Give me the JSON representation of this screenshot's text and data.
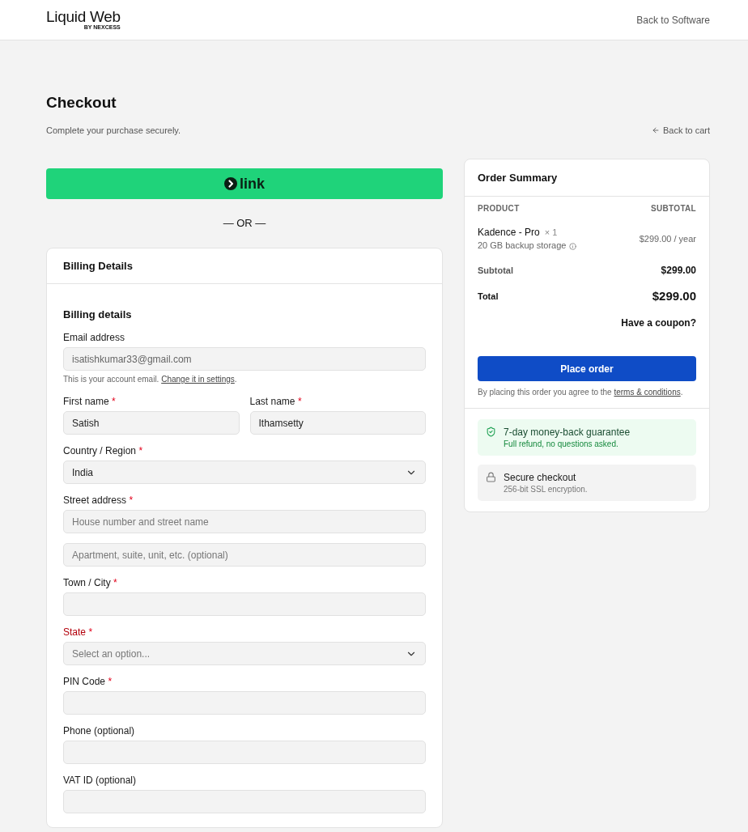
{
  "header": {
    "logo": "Liquid Web",
    "logo_byline": "BY NEXCESS",
    "back_link": "Back to Software"
  },
  "page": {
    "title": "Checkout",
    "subtitle": "Complete your purchase securely.",
    "back_link": "Back to cart"
  },
  "express": {
    "button_label": "link",
    "divider": "— OR —"
  },
  "billing": {
    "card_title": "Billing Details",
    "section_title": "Billing details",
    "rows": [
      {
        "fields": [
          {
            "kind": "text",
            "label": "Email address",
            "value": "isatishkumar33@gmail.com",
            "disabled": true,
            "invalid": false,
            "hint": {
              "text": "This is your account email.",
              "link": "Change it in settings",
              "end": "."
            }
          }
        ]
      },
      {
        "fields": [
          {
            "kind": "text",
            "label": "First name",
            "required_mark": "*",
            "value": "Satish",
            "disabled": false,
            "invalid": false
          },
          {
            "kind": "text",
            "label": "Last name",
            "required_mark": "*",
            "value": "Ithamsetty",
            "disabled": false,
            "invalid": false
          }
        ]
      },
      {
        "fields": [
          {
            "kind": "select",
            "label": "Country / Region",
            "required_mark": "*",
            "value": "India",
            "disabled": false,
            "invalid": false
          }
        ]
      },
      {
        "fields": [
          {
            "kind": "text",
            "label": "Street address",
            "required_mark": "*",
            "placeholder": "House number and street name",
            "disabled": false,
            "invalid": false
          }
        ]
      },
      {
        "fields": [
          {
            "kind": "text",
            "placeholder": "Apartment, suite, unit, etc. (optional)",
            "disabled": false,
            "invalid": false
          }
        ]
      },
      {
        "fields": [
          {
            "kind": "text",
            "label": "Town / City",
            "required_mark": "*",
            "invalid": false
          }
        ]
      },
      {
        "fields": [
          {
            "kind": "select",
            "label": "State",
            "required_mark": "*",
            "placeholder": "Select an option...",
            "disabled": false,
            "invalid": true
          }
        ]
      },
      {
        "fields": [
          {
            "kind": "text",
            "label": "PIN Code",
            "required_mark": "*",
            "invalid": false
          }
        ]
      },
      {
        "fields": [
          {
            "kind": "text",
            "label": "Phone (optional)",
            "invalid": false
          }
        ]
      },
      {
        "fields": [
          {
            "kind": "text",
            "label": "VAT ID (optional)",
            "invalid": false
          }
        ]
      }
    ]
  },
  "order_summary": {
    "title": "Order Summary",
    "columns": [
      "PRODUCT",
      "SUBTOTAL"
    ],
    "items": [
      {
        "name": "Kadence - Pro",
        "quantity": "× 1",
        "detail": "20 GB backup storage",
        "price": "$299.00 / year"
      }
    ],
    "subtotal": {
      "label": "Subtotal",
      "value": "$299.00"
    },
    "total": {
      "label": "Total",
      "value": "$299.00"
    },
    "coupon_link": "Have a coupon?",
    "place_order": "Place order",
    "terms": {
      "text": "By placing this order you agree to the",
      "link": "terms & conditions",
      "end": "."
    }
  },
  "badges": [
    {
      "kind": "guarantee",
      "title": "7-day money-back guarantee",
      "text": "Full refund, no questions asked."
    },
    {
      "kind": "secure",
      "title": "Secure checkout",
      "text": "256-bit SSL encryption."
    }
  ]
}
